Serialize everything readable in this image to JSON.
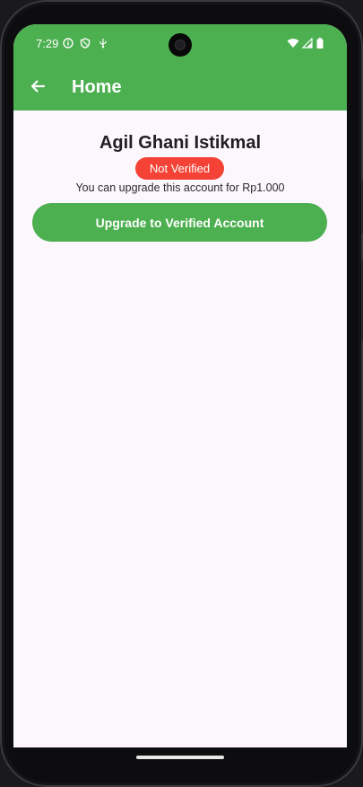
{
  "status_bar": {
    "time": "7:29",
    "left_icons": [
      "info-icon",
      "shield-icon",
      "usb-debug-icon"
    ],
    "right_icons": [
      "wifi-icon",
      "signal-icon",
      "battery-icon"
    ]
  },
  "app_bar": {
    "title": "Home",
    "back_icon": "arrow-left-icon"
  },
  "profile": {
    "name": "Agil Ghani Istikmal",
    "status": "Not Verified",
    "upgrade_info": "You can upgrade this account for Rp1.000",
    "upgrade_button": "Upgrade to Verified Account"
  },
  "colors": {
    "primary": "#4caf50",
    "badge_red": "#f44336",
    "background": "#fcf6fd"
  }
}
